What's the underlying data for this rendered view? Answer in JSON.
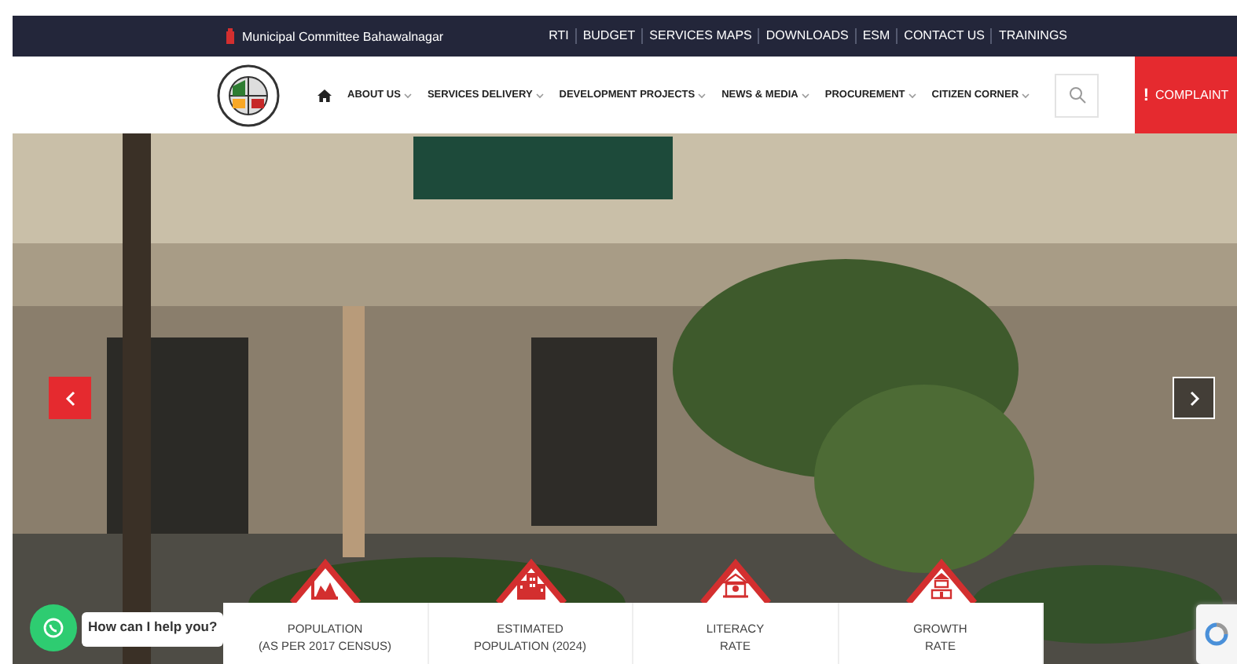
{
  "top_bar": {
    "site_name": "Municipal Committee Bahawalnagar",
    "links": [
      "RTI",
      "BUDGET",
      "SERVICES MAPS",
      "DOWNLOADS",
      "ESM",
      "CONTACT US",
      "TRAININGS"
    ]
  },
  "nav": {
    "items": [
      {
        "label": "ABOUT US",
        "has_menu": true
      },
      {
        "label": "SERVICES DELIVERY",
        "has_menu": true
      },
      {
        "label": "DEVELOPMENT PROJECTS",
        "has_menu": true
      },
      {
        "label": "NEWS & MEDIA",
        "has_menu": true
      },
      {
        "label": "PROCUREMENT",
        "has_menu": true
      },
      {
        "label": "CITIZEN CORNER",
        "has_menu": true
      }
    ],
    "complaint": {
      "mark": "!",
      "label": "COMPLAINT"
    }
  },
  "stats": [
    {
      "kind": "chart",
      "label": "POPULATION",
      "sublabel": "(AS PER 2017 CENSUS)"
    },
    {
      "kind": "buildings",
      "label": "ESTIMATED",
      "sublabel": "POPULATION (2024)"
    },
    {
      "kind": "school",
      "label": "LITERACY",
      "sublabel": "RATE"
    },
    {
      "kind": "tower",
      "label": "GROWTH",
      "sublabel": "RATE"
    }
  ],
  "chat": {
    "prompt": "How can I help you?"
  }
}
